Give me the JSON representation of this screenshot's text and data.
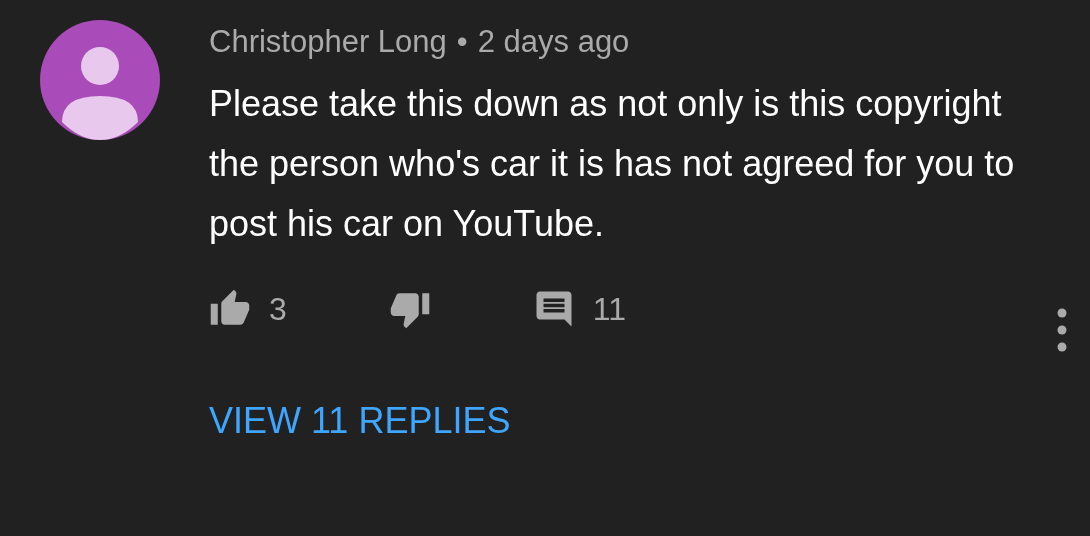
{
  "comment": {
    "author": "Christopher Long",
    "separator": "•",
    "time": "2 days ago",
    "text": "Please take this down as not only is this copyright the person who's car it is has not agreed for you to post his car on YouTube.",
    "likes": "3",
    "reply_count": "11",
    "view_replies": "VIEW 11 REPLIES"
  }
}
